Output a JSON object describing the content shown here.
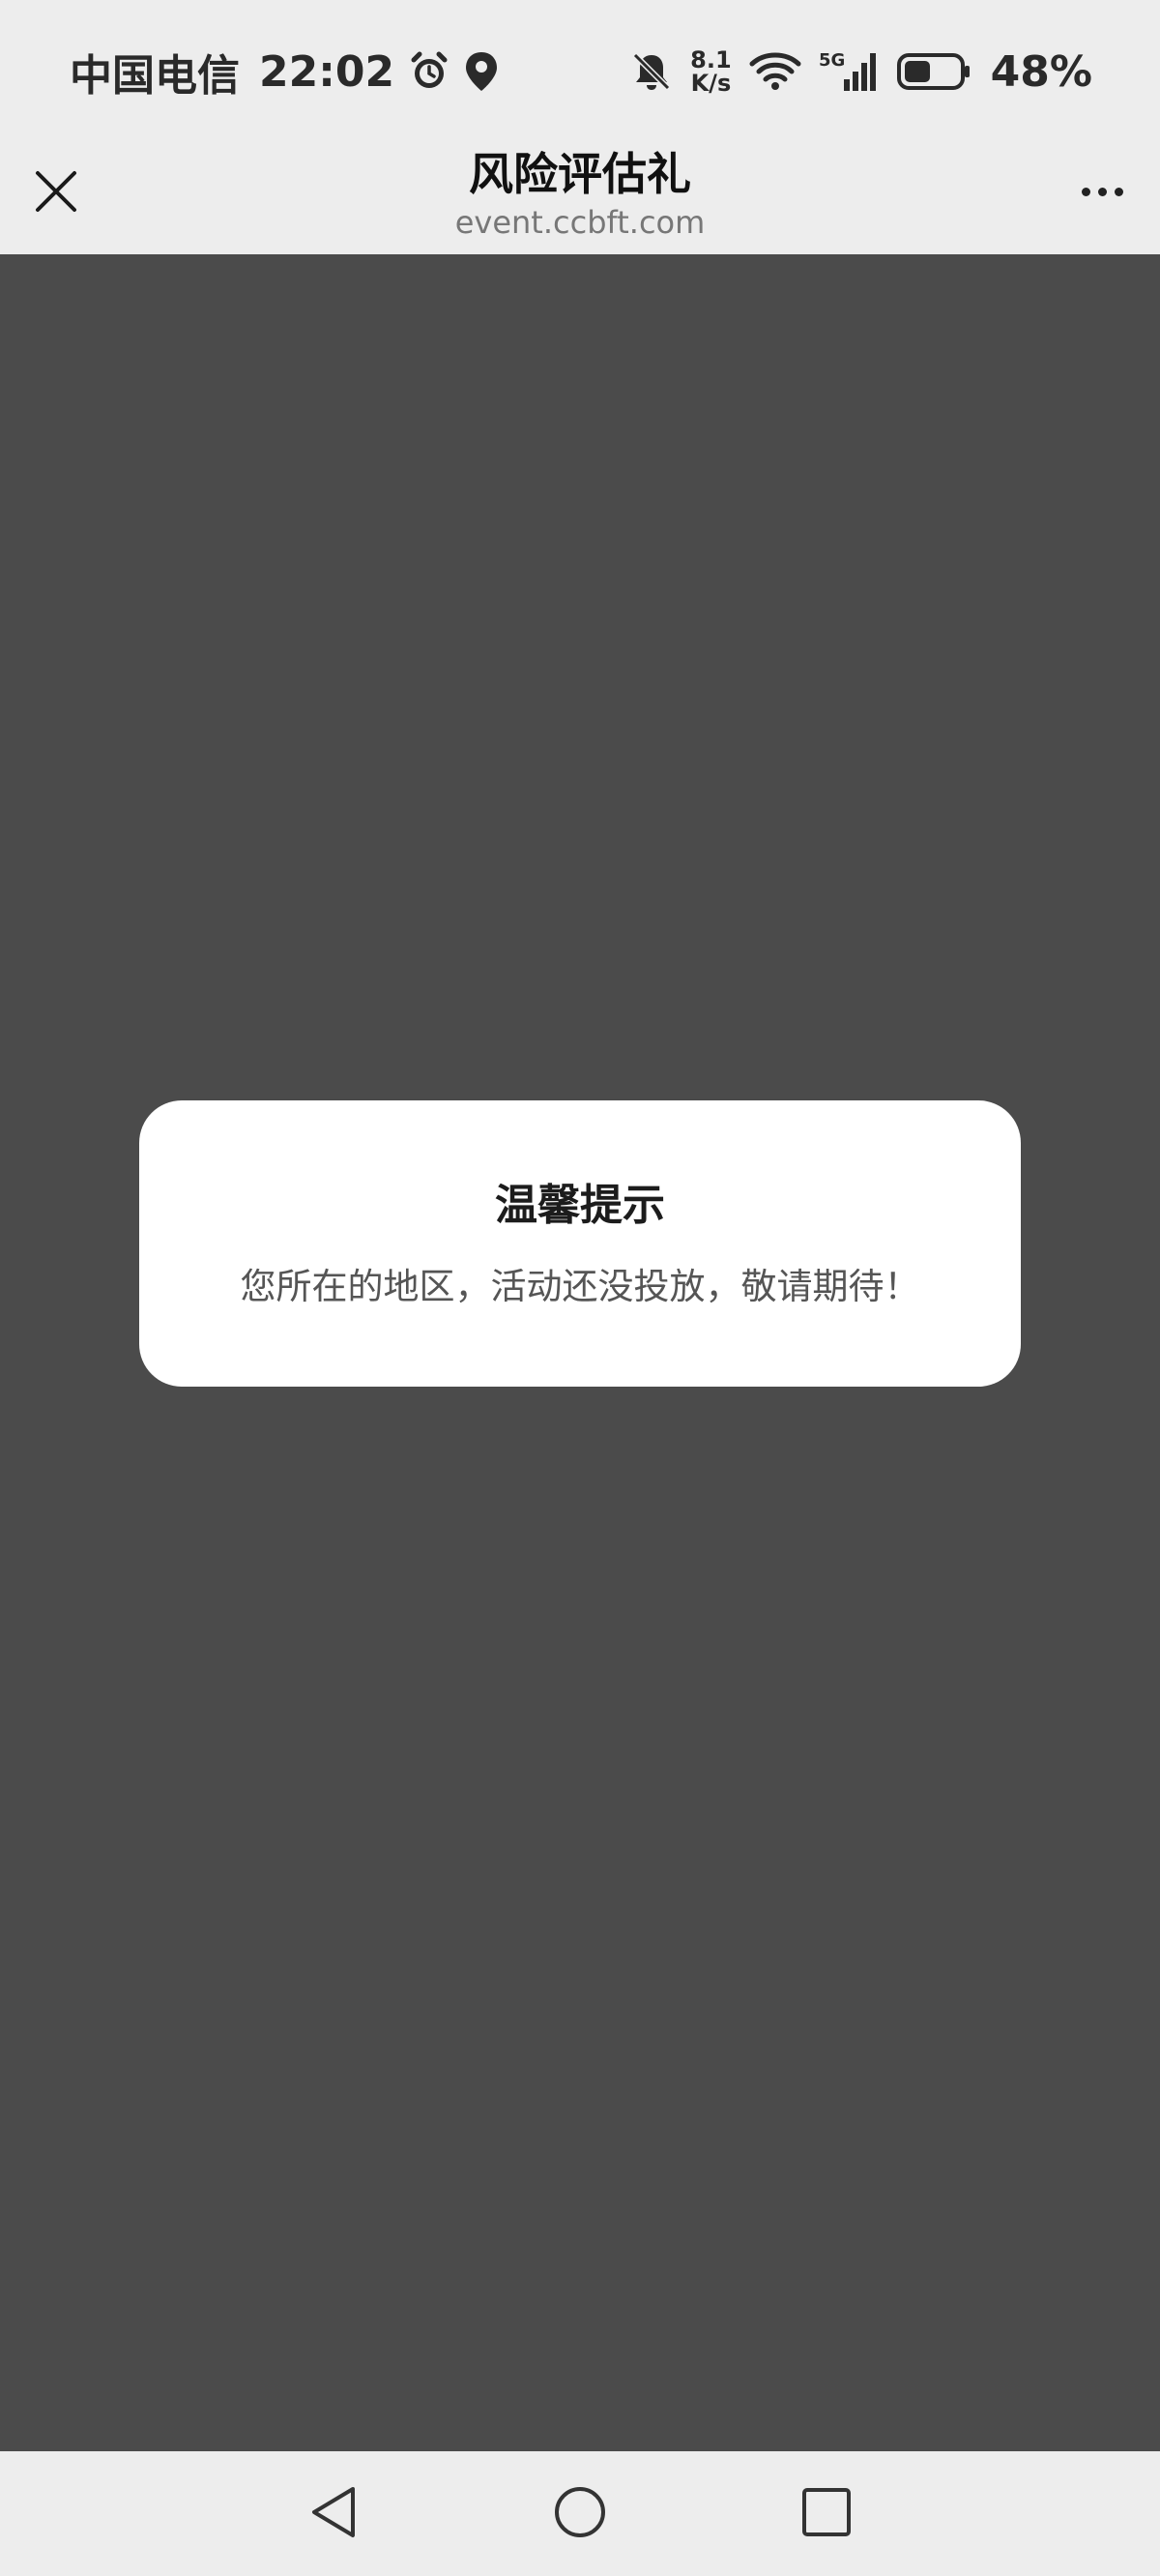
{
  "status_bar": {
    "carrier": "中国电信",
    "time": "22:02",
    "net_speed_value": "8.1",
    "net_speed_unit": "K/s",
    "network_type": "5G",
    "battery_percent": "48%",
    "battery_level": 0.48,
    "icons": [
      "alarm-icon",
      "location-icon",
      "mute-bell-icon",
      "wifi-icon",
      "signal-icon",
      "battery-icon"
    ]
  },
  "header": {
    "title": "风险评估礼",
    "domain": "event.ccbft.com",
    "icons": [
      "close-icon",
      "more-icon"
    ]
  },
  "dialog": {
    "title": "温馨提示",
    "message": "您所在的地区，活动还没投放，敬请期待！"
  },
  "nav_bar": {
    "icons": [
      "back-icon",
      "home-icon",
      "recent-apps-icon"
    ]
  },
  "colors": {
    "status_bg": "#ededed",
    "overlay": "#4b4b4b",
    "dialog_bg": "#ffffff",
    "text_primary": "#1c1c1c",
    "text_secondary": "#555555",
    "domain_text": "#777777"
  }
}
